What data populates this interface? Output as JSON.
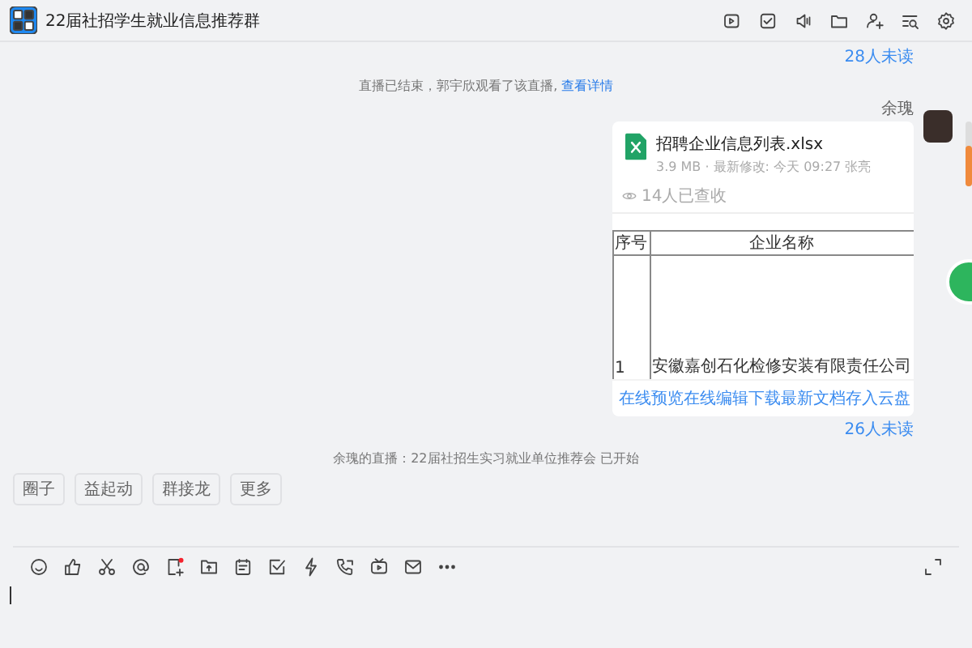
{
  "window": {
    "title": "22届社招学生就业信息推荐群"
  },
  "unread_top": "28人未读",
  "system_notice": {
    "text": "直播已结束，郭宇欣观看了该直播,",
    "link": "查看详情"
  },
  "message": {
    "sender": "余瑰",
    "file": {
      "name": "招聘企业信息列表.xlsx",
      "meta": "3.9 MB · 最新修改: 今天 09:27 张亮",
      "received": "14人已查收",
      "preview": {
        "columns": [
          "序号",
          "企业名称"
        ],
        "rows": [
          [
            "1",
            "安徽嘉创石化检修安装有限责任公司"
          ]
        ]
      },
      "actions": [
        "在线预览",
        "在线编辑",
        "下载最新文档",
        "存入云盘"
      ]
    },
    "unread": "26人未读"
  },
  "live_notice": "余瑰的直播：22届社招生实习就业单位推荐会 已开始",
  "chips": [
    "圈子",
    "益起动",
    "群接龙",
    "更多"
  ]
}
